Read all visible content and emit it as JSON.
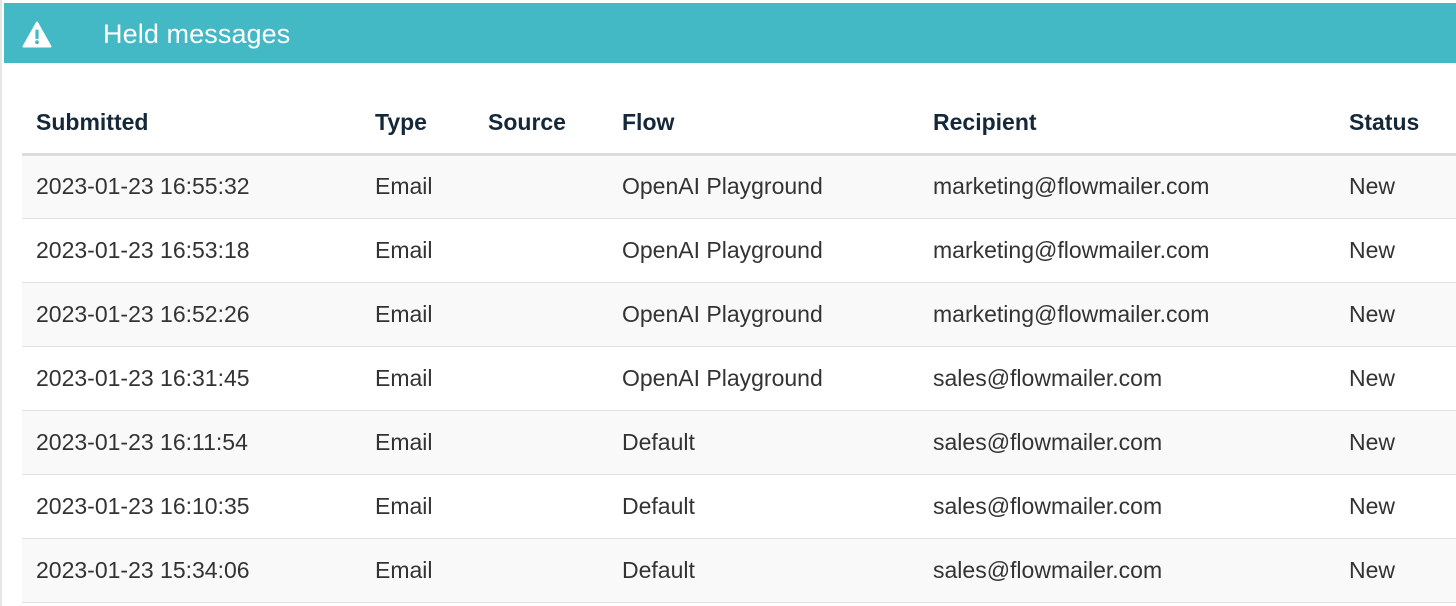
{
  "header": {
    "title": "Held messages",
    "icon": "warning-triangle-icon",
    "background_color": "#43b9c5"
  },
  "table": {
    "columns": [
      "Submitted",
      "Type",
      "Source",
      "Flow",
      "Recipient",
      "Status"
    ],
    "rows": [
      {
        "submitted": "2023-01-23 16:55:32",
        "type": "Email",
        "source": "",
        "flow": "OpenAI Playground",
        "recipient": "marketing@flowmailer.com",
        "status": "New"
      },
      {
        "submitted": "2023-01-23 16:53:18",
        "type": "Email",
        "source": "",
        "flow": "OpenAI Playground",
        "recipient": "marketing@flowmailer.com",
        "status": "New"
      },
      {
        "submitted": "2023-01-23 16:52:26",
        "type": "Email",
        "source": "",
        "flow": "OpenAI Playground",
        "recipient": "marketing@flowmailer.com",
        "status": "New"
      },
      {
        "submitted": "2023-01-23 16:31:45",
        "type": "Email",
        "source": "",
        "flow": "OpenAI Playground",
        "recipient": "sales@flowmailer.com",
        "status": "New"
      },
      {
        "submitted": "2023-01-23 16:11:54",
        "type": "Email",
        "source": "",
        "flow": "Default",
        "recipient": "sales@flowmailer.com",
        "status": "New"
      },
      {
        "submitted": "2023-01-23 16:10:35",
        "type": "Email",
        "source": "",
        "flow": "Default",
        "recipient": "sales@flowmailer.com",
        "status": "New"
      },
      {
        "submitted": "2023-01-23 15:34:06",
        "type": "Email",
        "source": "",
        "flow": "Default",
        "recipient": "sales@flowmailer.com",
        "status": "New"
      }
    ]
  }
}
